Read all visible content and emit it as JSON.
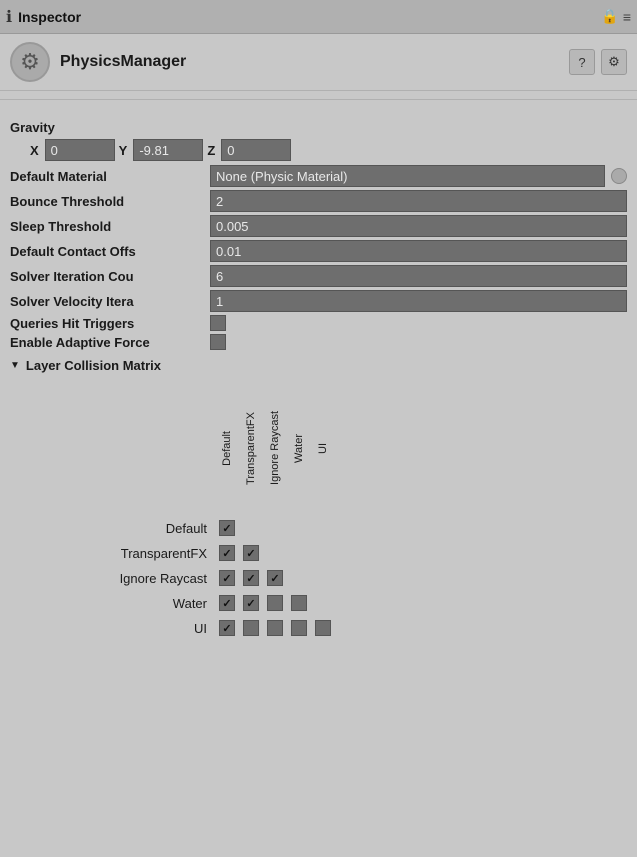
{
  "titleBar": {
    "icon": "ℹ",
    "label": "Inspector",
    "lockIcon": "🔒",
    "menuIcon": "≡"
  },
  "component": {
    "title": "PhysicsManager",
    "helpLabel": "?",
    "settingsLabel": "⚙"
  },
  "properties": {
    "gravityLabel": "Gravity",
    "gravityX": {
      "axis": "X",
      "value": "0"
    },
    "gravityY": {
      "axis": "Y",
      "value": "-9.81"
    },
    "gravityZ": {
      "axis": "Z",
      "value": "0"
    },
    "defaultMaterial": {
      "label": "Default Material",
      "value": "None (Physic Material)"
    },
    "bounceThreshold": {
      "label": "Bounce Threshold",
      "value": "2"
    },
    "sleepThreshold": {
      "label": "Sleep Threshold",
      "value": "0.005"
    },
    "defaultContactOffs": {
      "label": "Default Contact Offs",
      "value": "0.01"
    },
    "solverIterationCou": {
      "label": "Solver Iteration Cou",
      "value": "6"
    },
    "solverVelocityItera": {
      "label": "Solver Velocity Itera",
      "value": "1"
    },
    "queriesHitTriggers": {
      "label": "Queries Hit Triggers",
      "checked": true
    },
    "enableAdaptiveForce": {
      "label": "Enable Adaptive Force",
      "checked": false
    }
  },
  "matrix": {
    "sectionLabel": "Layer Collision Matrix",
    "colHeaders": [
      "Default",
      "TransparentFX",
      "Ignore Raycast",
      "Water",
      "UI"
    ],
    "rows": [
      {
        "label": "Default",
        "cells": [
          true,
          true,
          true,
          true,
          true
        ]
      },
      {
        "label": "TransparentFX",
        "cells": [
          true,
          true,
          true,
          true,
          false
        ]
      },
      {
        "label": "Ignore Raycast",
        "cells": [
          true,
          true,
          true,
          false,
          false
        ]
      },
      {
        "label": "Water",
        "cells": [
          true,
          true,
          false,
          false,
          false
        ]
      },
      {
        "label": "UI",
        "cells": [
          true,
          false,
          false,
          false,
          false
        ]
      }
    ]
  }
}
